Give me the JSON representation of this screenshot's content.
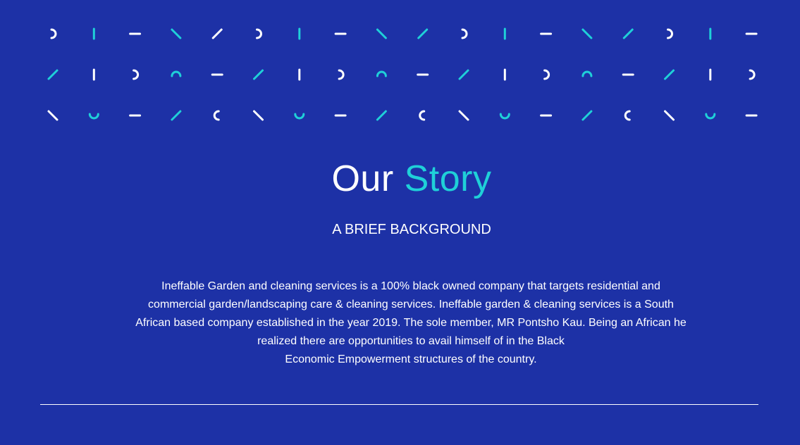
{
  "colors": {
    "background": "#1d31a6",
    "text": "#ffffff",
    "accent": "#1fd0d8"
  },
  "pattern": {
    "icon": "geometric-glyph-pattern",
    "rows": [
      [
        {
          "shape": "arc-right",
          "color": "white"
        },
        {
          "shape": "vertical",
          "color": "cyan"
        },
        {
          "shape": "horizontal",
          "color": "white"
        },
        {
          "shape": "backslash",
          "color": "cyan"
        },
        {
          "shape": "slash",
          "color": "white"
        },
        {
          "shape": "arc-right",
          "color": "white"
        },
        {
          "shape": "vertical",
          "color": "cyan"
        },
        {
          "shape": "horizontal",
          "color": "white"
        },
        {
          "shape": "backslash",
          "color": "cyan"
        },
        {
          "shape": "slash",
          "color": "cyan"
        },
        {
          "shape": "arc-right",
          "color": "white"
        },
        {
          "shape": "vertical",
          "color": "cyan"
        },
        {
          "shape": "horizontal",
          "color": "white"
        },
        {
          "shape": "backslash",
          "color": "cyan"
        },
        {
          "shape": "slash",
          "color": "cyan"
        },
        {
          "shape": "arc-right",
          "color": "white"
        },
        {
          "shape": "vertical",
          "color": "cyan"
        },
        {
          "shape": "horizontal",
          "color": "white"
        }
      ],
      [
        {
          "shape": "slash",
          "color": "cyan"
        },
        {
          "shape": "vertical",
          "color": "white"
        },
        {
          "shape": "arc-right",
          "color": "white"
        },
        {
          "shape": "arc-top",
          "color": "cyan"
        },
        {
          "shape": "horizontal",
          "color": "white"
        },
        {
          "shape": "slash",
          "color": "cyan"
        },
        {
          "shape": "vertical",
          "color": "white"
        },
        {
          "shape": "arc-right",
          "color": "white"
        },
        {
          "shape": "arc-top",
          "color": "cyan"
        },
        {
          "shape": "horizontal",
          "color": "white"
        },
        {
          "shape": "slash",
          "color": "cyan"
        },
        {
          "shape": "vertical",
          "color": "white"
        },
        {
          "shape": "arc-right",
          "color": "white"
        },
        {
          "shape": "arc-top",
          "color": "cyan"
        },
        {
          "shape": "horizontal",
          "color": "white"
        },
        {
          "shape": "slash",
          "color": "cyan"
        },
        {
          "shape": "vertical",
          "color": "white"
        },
        {
          "shape": "arc-right",
          "color": "white"
        }
      ],
      [
        {
          "shape": "backslash",
          "color": "white"
        },
        {
          "shape": "arc-bottom",
          "color": "cyan"
        },
        {
          "shape": "horizontal",
          "color": "white"
        },
        {
          "shape": "slash",
          "color": "cyan"
        },
        {
          "shape": "arc-left",
          "color": "white"
        },
        {
          "shape": "backslash",
          "color": "white"
        },
        {
          "shape": "arc-bottom",
          "color": "cyan"
        },
        {
          "shape": "horizontal",
          "color": "white"
        },
        {
          "shape": "slash",
          "color": "cyan"
        },
        {
          "shape": "arc-left",
          "color": "white"
        },
        {
          "shape": "backslash",
          "color": "white"
        },
        {
          "shape": "arc-bottom",
          "color": "cyan"
        },
        {
          "shape": "horizontal",
          "color": "white"
        },
        {
          "shape": "slash",
          "color": "cyan"
        },
        {
          "shape": "arc-left",
          "color": "white"
        },
        {
          "shape": "backslash",
          "color": "white"
        },
        {
          "shape": "arc-bottom",
          "color": "cyan"
        },
        {
          "shape": "horizontal",
          "color": "white"
        }
      ]
    ]
  },
  "story": {
    "title_main": "Our",
    "title_accent": "Story",
    "subtitle": "A BRIEF BACKGROUND",
    "paragraph_lines": [
      "Ineffable Garden and cleaning services is a 100% black owned company that targets residential and",
      "commercial garden/landscaping care & cleaning services. Ineffable garden & cleaning services is a South",
      "African based company established in the year 2019. The sole member, MR Pontsho Kau. Being an African he",
      "realized there are opportunities to avail himself of in the Black",
      "Economic Empowerment structures of the country."
    ]
  }
}
